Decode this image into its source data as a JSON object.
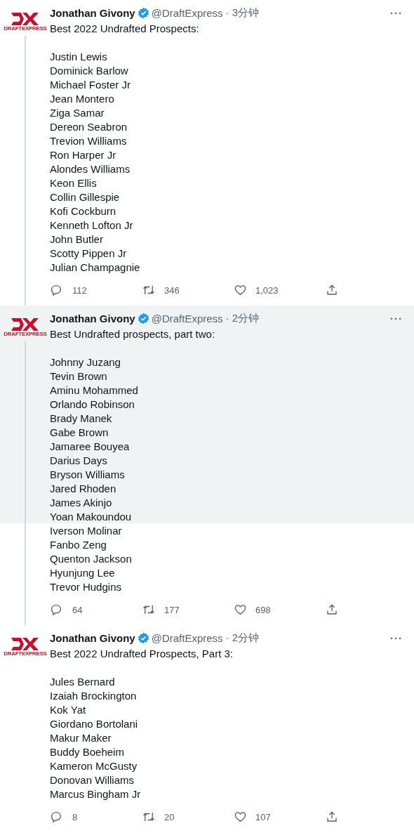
{
  "tweets": [
    {
      "logo_text": "DRAFTEXPRESS",
      "author": "Jonathan Givony",
      "verified": true,
      "handle": "@DraftExpress",
      "time": "· 3分钟",
      "more": "···",
      "thread_continues": true,
      "highlighted": false,
      "text": "Best 2022 Undrafted Prospects:",
      "list": [
        "Justin Lewis",
        "Dominick Barlow",
        "Michael Foster Jr",
        "Jean Montero",
        "Ziga Samar",
        "Dereon Seabron",
        "Trevion Williams",
        "Ron Harper Jr",
        "Alondes Williams",
        "Keon Ellis",
        "Collin Gillespie",
        "Kofi Cockburn",
        "Kenneth Lofton Jr",
        "John Butler",
        "Scotty Pippen Jr",
        "Julian Champagnie"
      ],
      "replies": "112",
      "retweets": "346",
      "likes": "1,023"
    },
    {
      "logo_text": "DRAFTEXPRESS",
      "author": "Jonathan Givony",
      "verified": true,
      "handle": "@DraftExpress",
      "time": "· 2分钟",
      "more": "···",
      "thread_continues": true,
      "highlighted": true,
      "text": "Best Undrafted prospects, part two:",
      "list": [
        "Johnny Juzang",
        "Tevin Brown",
        "Aminu Mohammed",
        "Orlando Robinson",
        "Brady Manek",
        "Gabe Brown",
        "Jamaree Bouyea",
        "Darius Days",
        "Bryson Williams",
        "Jared Rhoden",
        "James Akinjo",
        "Yoan Makoundou",
        "Iverson Molinar",
        "Fanbo Zeng",
        "Quenton Jackson",
        "Hyunjung Lee",
        "Trevor Hudgins"
      ],
      "replies": "64",
      "retweets": "177",
      "likes": "698"
    },
    {
      "logo_text": "DRAFTEXPRESS",
      "author": "Jonathan Givony",
      "verified": true,
      "handle": "@DraftExpress",
      "time": "· 2分钟",
      "more": "···",
      "thread_continues": false,
      "highlighted": false,
      "text": "Best 2022 Undrafted Prospects, Part 3:",
      "list": [
        "Jules Bernard",
        "Izaiah Brockington",
        "Kok Yat",
        "Giordano Bortolani",
        "Makur Maker",
        "Buddy Boeheim",
        "Kameron McGusty",
        "Donovan Williams",
        "Marcus Bingham Jr"
      ],
      "replies": "8",
      "retweets": "20",
      "likes": "107"
    }
  ]
}
